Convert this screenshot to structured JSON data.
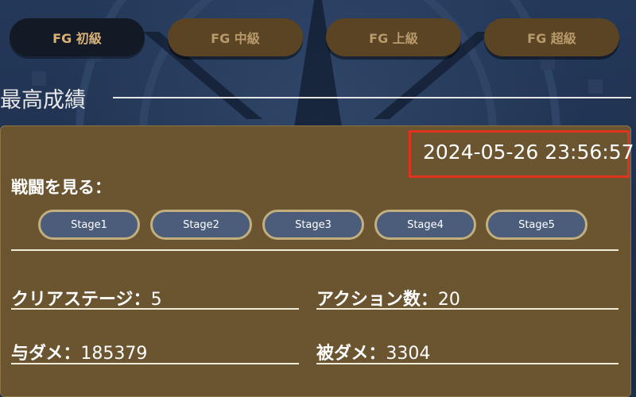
{
  "tabs": [
    {
      "label": "FG 初級",
      "active": true
    },
    {
      "label": "FG 中級",
      "active": false
    },
    {
      "label": "FG 上級",
      "active": false
    },
    {
      "label": "FG 超級",
      "active": false
    }
  ],
  "section": {
    "title": "最高成績"
  },
  "record": {
    "timestamp": "2024-05-26 23:56:57",
    "battle_label": "戦闘を見る：",
    "stages": [
      "Stage1",
      "Stage2",
      "Stage3",
      "Stage4",
      "Stage5"
    ],
    "stats": {
      "clear_stage_label": "クリアステージ：",
      "clear_stage_value": "5",
      "actions_label": "アクション数：",
      "actions_value": "20",
      "damage_dealt_label": "与ダメ：",
      "damage_dealt_value": "185379",
      "damage_taken_label": "被ダメ：",
      "damage_taken_value": "3304"
    }
  },
  "colors": {
    "card_bg": "#6a5530",
    "tab_bg": "#5a4423",
    "tab_active_bg": "#141a25",
    "highlight": "#e0331e",
    "stage_btn_bg": "#4b5d7a"
  }
}
